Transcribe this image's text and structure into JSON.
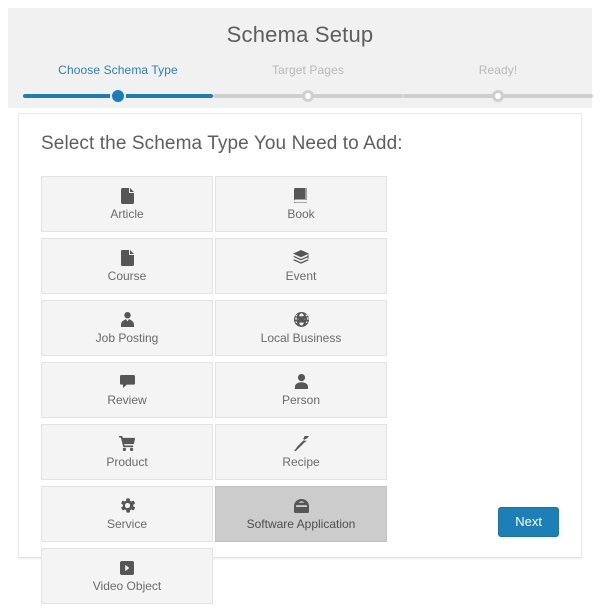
{
  "header": {
    "title": "Schema Setup",
    "steps": [
      {
        "label": "Choose Schema Type",
        "state": "active"
      },
      {
        "label": "Target Pages",
        "state": "inactive"
      },
      {
        "label": "Ready!",
        "state": "inactive"
      }
    ]
  },
  "panel": {
    "heading": "Select the Schema Type You Need to Add:",
    "cards": [
      {
        "label": "Article",
        "icon": "file-icon",
        "selected": false
      },
      {
        "label": "Book",
        "icon": "book-icon",
        "selected": false
      },
      {
        "label": "Course",
        "icon": "file-icon",
        "selected": false
      },
      {
        "label": "Event",
        "icon": "ticket-stack-icon",
        "selected": false
      },
      {
        "label": "Job Posting",
        "icon": "user-tie-icon",
        "selected": false
      },
      {
        "label": "Local Business",
        "icon": "globe-icon",
        "selected": false
      },
      {
        "label": "Review",
        "icon": "comment-icon",
        "selected": false
      },
      {
        "label": "Person",
        "icon": "user-icon",
        "selected": false
      },
      {
        "label": "Product",
        "icon": "shopping-cart-icon",
        "selected": false
      },
      {
        "label": "Recipe",
        "icon": "carrot-icon",
        "selected": false
      },
      {
        "label": "Service",
        "icon": "gear-icon",
        "selected": false
      },
      {
        "label": "Software Application",
        "icon": "app-window-icon",
        "selected": true
      },
      {
        "label": "Video Object",
        "icon": "play-square-icon",
        "selected": false
      }
    ],
    "next_label": "Next"
  },
  "colors": {
    "accent": "#1b7dba",
    "header_band": "#f1f1f1",
    "card_bg": "#f4f4f4",
    "card_selected_bg": "#cccccc",
    "text_gray": "#5e5e5e",
    "step_inactive": "#b9b9b9"
  }
}
